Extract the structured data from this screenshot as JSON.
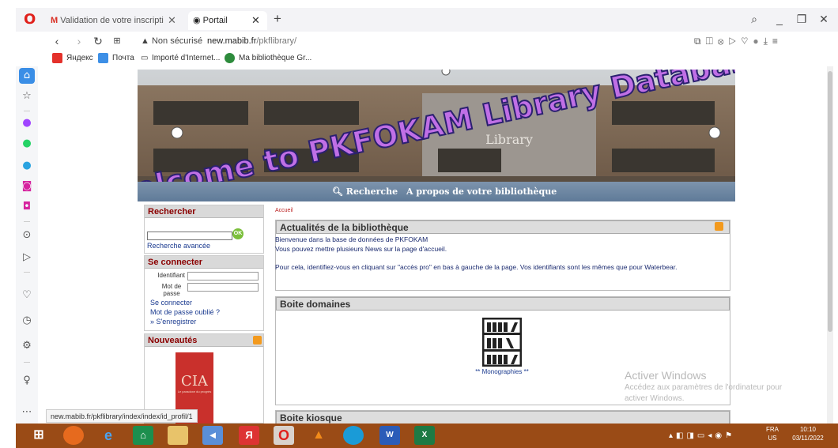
{
  "browser": {
    "tabs": [
      {
        "label": "Validation de votre inscripti"
      },
      {
        "label": "Portail"
      }
    ],
    "address": {
      "security": "Non sécurisé",
      "domain": "new.mabib.fr",
      "path": "/pkflibrary/"
    },
    "bookmarks": [
      "Яндекс",
      "Почта",
      "Importé d'Internet...",
      "Ma bibliothèque Gr..."
    ],
    "status_url": "new.mabib.fr/pkflibrary/index/index/id_profil/1"
  },
  "page": {
    "banner_title": "Welcome to PKFOKAM Library Database",
    "banner_sign": "Library",
    "nav": {
      "search": "Recherche",
      "about": "A propos de votre bibliothèque"
    },
    "breadcrumb": "Accueil",
    "left": {
      "search_title": "Rechercher",
      "ok": "OK",
      "advanced": "Recherche avancée",
      "login_title": "Se connecter",
      "id_label": "Identifiant",
      "pw_label": "Mot de passe",
      "login_link": "Se connecter",
      "forgot": "Mot de passe oublié ?",
      "register": "» S'enregistrer",
      "news_title": "Nouveautés",
      "book_title": "CIA",
      "book_sub": "Le paradoxe du progrès"
    },
    "main": {
      "news_title": "Actualités de la bibliothèque",
      "news_1": "Bienvenue dans la base de données de PKFOKAM",
      "news_2": "Vous pouvez mettre plusieurs News sur la page d'accueil.",
      "news_3": "Pour cela, identifiez-vous en cliquant sur \"accès pro\" en bas à gauche de la page. Vos identifiants sont les mêmes que pour Waterbear.",
      "domains_title": "Boite domaines",
      "domain_item": "** Monographies **",
      "kiosk_title": "Boite kiosque"
    },
    "watermark": {
      "line1": "Activer Windows",
      "line2": "Accédez aux paramètres de l'ordinateur pour",
      "line3": "activer Windows."
    }
  },
  "taskbar": {
    "lang": "FRA",
    "region": "US",
    "time": "10:10",
    "date": "03/11/2022"
  },
  "colors": {
    "taskbar": "#9a4b16",
    "nav": "#6b84a1",
    "accent_red": "#8b0000"
  }
}
